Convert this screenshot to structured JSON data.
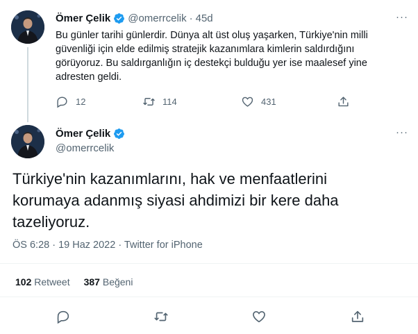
{
  "tweet1": {
    "name": "Ömer Çelik",
    "handle": "@omerrcelik",
    "dot": "·",
    "time": "45d",
    "text": "Bu günler tarihi günlerdir. Dünya alt üst oluş yaşarken, Türkiye'nin milli güvenliği için elde edilmiş stratejik kazanımlara kimlerin saldırdığını görüyoruz. Bu saldırganlığın iç destekçi bulduğu yer ise maalesef yine adresten geldi.",
    "lines": [
      "Bu günler tarihi günlerdir. Dünya alt üst oluş yaşarken, Türkiye'nin milli",
      "güvenliği için elde edilmiş stratejik kazanımlara kimlerin saldırdığını",
      "görüyoruz. Bu saldırganlığın iç destekçi bulduğu yer ise maalesef yine",
      "adresten geldi."
    ],
    "replies": "12",
    "retweets": "114",
    "likes": "431"
  },
  "tweet2": {
    "name": "Ömer Çelik",
    "handle": "@omerrcelik",
    "lines": [
      "Türkiye'nin kazanımlarını, hak ve menfaatlerini",
      "korumaya adanmış siyasi ahdimizi bir kere daha",
      "tazeliyoruz."
    ],
    "meta": "ÖS 6:28 · 19 Haz 2022 · Twitter for iPhone",
    "retweet_count": "102",
    "retweet_label": "Retweet",
    "like_count": "387",
    "like_label": "Beğeni"
  },
  "more_label": "···",
  "colors": {
    "verified": "#1d9bf0",
    "muted": "#536471",
    "divider": "#eff3f4"
  },
  "icons": [
    "verified-badge-icon",
    "more-icon",
    "reply-icon",
    "retweet-icon",
    "like-icon",
    "share-icon"
  ]
}
